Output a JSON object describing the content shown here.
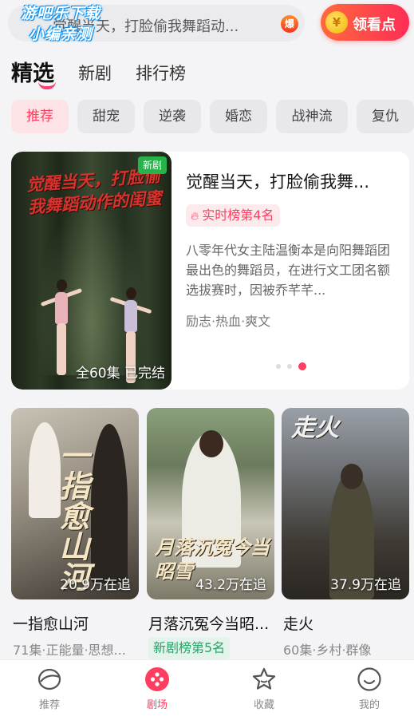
{
  "header": {
    "watermark_line1": "游吧乐下载",
    "watermark_line2": "小编亲测",
    "search_text": "觉醒当天，打脸偷我舞蹈动...",
    "hot_badge": "爆",
    "watch_points_label": "领看点",
    "coin_symbol": "¥"
  },
  "tabs": [
    {
      "label": "精选",
      "active": true
    },
    {
      "label": "新剧",
      "active": false
    },
    {
      "label": "排行榜",
      "active": false
    }
  ],
  "chips": [
    {
      "label": "推荐",
      "active": true
    },
    {
      "label": "甜宠",
      "active": false
    },
    {
      "label": "逆袭",
      "active": false
    },
    {
      "label": "婚恋",
      "active": false
    },
    {
      "label": "战神流",
      "active": false
    },
    {
      "label": "复仇",
      "active": false
    }
  ],
  "featured": {
    "poster_title": "觉醒当天，打脸偷我舞蹈动作的闺蜜",
    "new_badge": "新剧",
    "status": "全60集 已完结",
    "title": "觉醒当天，打脸偷我舞...",
    "rank": "实时榜第4名",
    "description": "八零年代女主陆温衡本是向阳舞蹈团最出色的舞蹈员，在进行文工团名额选拔赛时，因被乔芊芊...",
    "tags": "励志·热血·爽文",
    "carousel_total": 3,
    "carousel_active": 3
  },
  "cards": [
    {
      "poster_text": "一指愈山河",
      "count": "20.9万在追",
      "title": "一指愈山河",
      "meta": "71集·正能量·思想...",
      "badge": null
    },
    {
      "poster_text": "月落沉冤今当昭雪",
      "count": "43.2万在追",
      "title": "月落沉冤今当昭...",
      "meta": null,
      "badge": "新剧榜第5名"
    },
    {
      "poster_text": "走火",
      "count": "37.9万在追",
      "title": "走火",
      "meta": "60集·乡村·群像",
      "badge": null
    }
  ],
  "bottom_nav": [
    {
      "label": "推荐",
      "icon": "recommend-icon",
      "active": false
    },
    {
      "label": "剧场",
      "icon": "theater-icon",
      "active": true
    },
    {
      "label": "收藏",
      "icon": "star-icon",
      "active": false
    },
    {
      "label": "我的",
      "icon": "smile-profile-icon",
      "active": false
    }
  ],
  "colors": {
    "accent": "#ff3d60",
    "green_badge": "#27b24a",
    "rank_green": "#22a567"
  }
}
